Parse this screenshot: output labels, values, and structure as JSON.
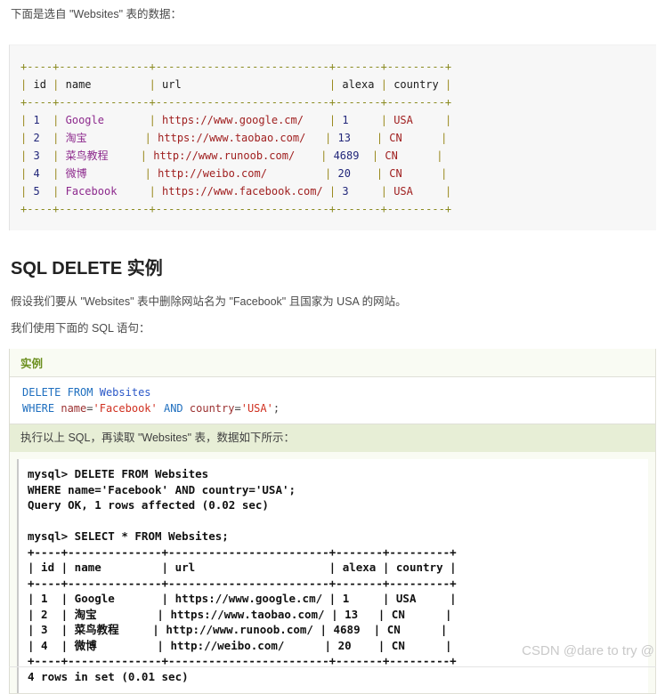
{
  "intro": {
    "text": "下面是选自 \"Websites\" 表的数据："
  },
  "websites_table": {
    "rule": "+----+--------------+---------------------------+-------+---------+",
    "header": {
      "id": "id",
      "name": "name",
      "url": "url",
      "alexa": "alexa",
      "country": "country"
    },
    "rows": [
      {
        "id": "1",
        "name": "Google",
        "url": "https://www.google.cm/",
        "alexa": "1",
        "country": "USA"
      },
      {
        "id": "2",
        "name": "淘宝",
        "url": "https://www.taobao.com/",
        "alexa": "13",
        "country": "CN"
      },
      {
        "id": "3",
        "name": "菜鸟教程",
        "url": "http://www.runoob.com/",
        "alexa": "4689",
        "country": "CN"
      },
      {
        "id": "4",
        "name": "微博",
        "url": "http://weibo.com/",
        "alexa": "20",
        "country": "CN"
      },
      {
        "id": "5",
        "name": "Facebook",
        "url": "https://www.facebook.com/",
        "alexa": "3",
        "country": "USA"
      }
    ]
  },
  "section": {
    "title": "SQL DELETE 实例",
    "desc_1": "假设我们要从 \"Websites\" 表中删除网站名为 \"Facebook\" 且国家为 USA 的网站。",
    "desc_2": "我们使用下面的 SQL 语句："
  },
  "example": {
    "label": "实例",
    "sql_line_1": {
      "kw_delete": "DELETE",
      "kw_from": "FROM",
      "table": "Websites"
    },
    "sql_line_2": {
      "kw_where": "WHERE",
      "col_name": "name",
      "eq1": "=",
      "str_facebook": "'Facebook'",
      "kw_and": "AND",
      "col_country": "country",
      "eq2": "=",
      "str_usa": "'USA'",
      "semicolon": ";"
    },
    "exec_note": "执行以上 SQL，再读取 \"Websites\" 表，数据如下所示："
  },
  "terminal": {
    "lines": [
      "mysql> DELETE FROM Websites",
      "WHERE name='Facebook' AND country='USA';",
      "Query OK, 1 rows affected (0.02 sec)",
      "",
      "mysql> SELECT * FROM Websites;",
      "+----+--------------+------------------------+-------+---------+",
      "| id | name         | url                    | alexa | country |",
      "+----+--------------+------------------------+-------+---------+",
      "| 1  | Google       | https://www.google.cm/ | 1     | USA     |",
      "| 2  | 淘宝         | https://www.taobao.com/ | 13   | CN      |",
      "| 3  | 菜鸟教程     | http://www.runoob.com/ | 4689  | CN      |",
      "| 4  | 微博         | http://weibo.com/      | 20    | CN      |",
      "+----+--------------+------------------------+-------+---------+",
      "4 rows in set (0.01 sec)"
    ]
  },
  "watermark": {
    "text": "CSDN @dare to try @"
  }
}
